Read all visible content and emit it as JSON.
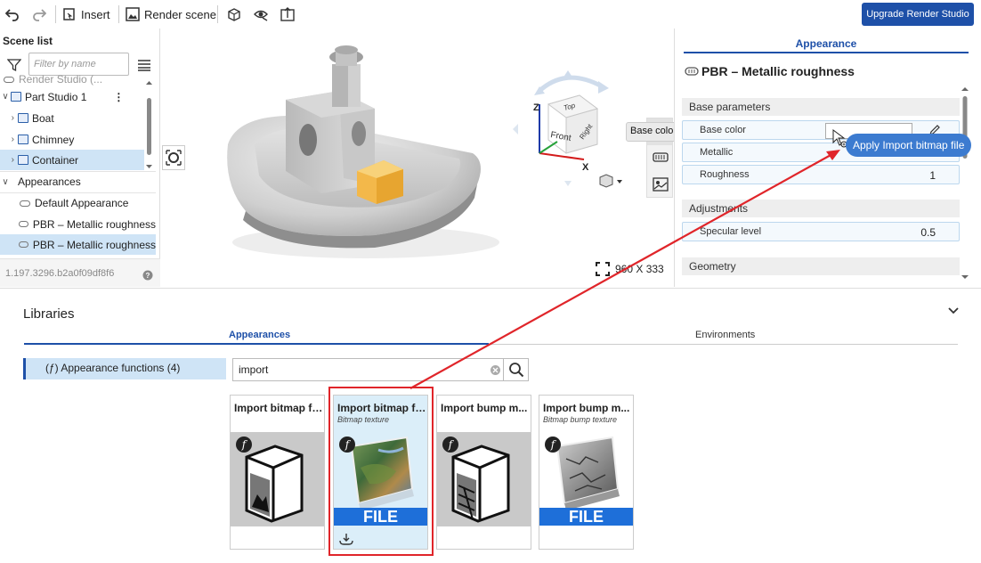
{
  "toolbar": {
    "insert_label": "Insert",
    "render_label": "Render scene",
    "upgrade_label": "Upgrade Render Studio"
  },
  "scene_list": {
    "title": "Scene list",
    "filter_placeholder": "Filter by name",
    "root_label": "Render Studio (...",
    "items": [
      {
        "label": "Part Studio 1"
      },
      {
        "label": "Boat"
      },
      {
        "label": "Chimney"
      },
      {
        "label": "Container"
      }
    ],
    "appearances_label": "Appearances",
    "appearance_items": [
      {
        "label": "Default Appearance"
      },
      {
        "label": "PBR – Metallic roughness"
      },
      {
        "label": "PBR – Metallic roughness"
      }
    ],
    "version": "1.197.3296.b2a0f09df8f6"
  },
  "viewport": {
    "cube_faces": {
      "top": "Top",
      "front": "Front",
      "right": "Right"
    },
    "axes": {
      "x": "X",
      "z": "Z"
    },
    "resolution": "960 X 333",
    "base_color_tip": "Base color"
  },
  "appearance_panel": {
    "tab": "Appearance",
    "title": "PBR – Metallic roughness",
    "base_section": "Base parameters",
    "params": [
      {
        "label": "Base color",
        "value": ""
      },
      {
        "label": "Metallic",
        "value": "1"
      },
      {
        "label": "Roughness",
        "value": "1"
      }
    ],
    "adjustments_section": "Adjustments",
    "specular_label": "Specular level",
    "specular_value": "0.5",
    "geometry_section": "Geometry",
    "apply_tip": "Apply Import bitmap file"
  },
  "libraries": {
    "title": "Libraries",
    "tabs": {
      "appearances": "Appearances",
      "environments": "Environments"
    },
    "functions_item": "(ƒ) Appearance functions (4)",
    "search_value": "import",
    "cards": [
      {
        "title": "Import bitmap fi...",
        "subtitle": "",
        "file_label": ""
      },
      {
        "title": "Import bitmap fi...",
        "subtitle": "Bitmap texture",
        "file_label": "FILE"
      },
      {
        "title": "Import bump m...",
        "subtitle": "",
        "file_label": ""
      },
      {
        "title": "Import bump m...",
        "subtitle": "Bitmap bump texture",
        "file_label": "FILE"
      }
    ],
    "f_badge": "f"
  },
  "colors": {
    "accent": "#1e50a8",
    "selection": "#cfe4f6",
    "arrow": "#e0252a",
    "file_band": "#1e6fd9",
    "cube_highlight": "#f3c24a"
  }
}
